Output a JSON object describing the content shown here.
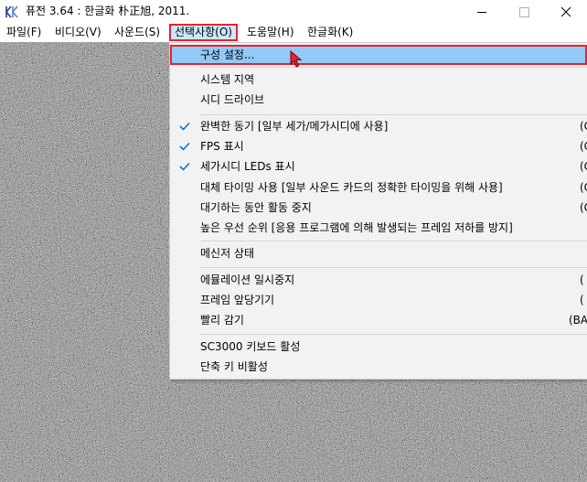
{
  "window": {
    "title": "퓨전 3.64 : 한글화 朴正旭, 2011.",
    "icon": "fusion-app-icon"
  },
  "colors": {
    "highlight_border": "#e8232f",
    "menu_hover": "#cce8ff",
    "item_highlight": "#91c9f7",
    "check": "#0078d7",
    "cursor": "#e8232f"
  },
  "menubar": {
    "items": [
      {
        "label": "파일(F)"
      },
      {
        "label": "비디오(V)"
      },
      {
        "label": "사운드(S)"
      },
      {
        "label": "선택사항(O)"
      },
      {
        "label": "도움말(H)"
      },
      {
        "label": "한글화(K)"
      }
    ]
  },
  "dropdown": {
    "items": [
      {
        "label": "구성 설정...",
        "shortcut": "",
        "checked": false
      },
      {
        "label": "시스템 지역",
        "shortcut": "",
        "checked": false
      },
      {
        "label": "시디 드라이브",
        "shortcut": "",
        "checked": false
      },
      {
        "label": "완벽한 동기 [일부 세가/메가시디에 사용]",
        "shortcut": "(C",
        "checked": true
      },
      {
        "label": "FPS 표시",
        "shortcut": "(C",
        "checked": true
      },
      {
        "label": "세가시디 LEDs 표시",
        "shortcut": "(C",
        "checked": true
      },
      {
        "label": "대체 타이밍 사용 [일부 사운드 카드의 정확한 타이밍을 위해 사용]",
        "shortcut": "(C",
        "checked": false
      },
      {
        "label": "대기하는 동안 활동 중지",
        "shortcut": "(C",
        "checked": false
      },
      {
        "label": "높은 우선 순위 [응용 프로그램에 의해 발생되는 프레임 저하를 방지]",
        "shortcut": "",
        "checked": false
      },
      {
        "label": "메신저 상태",
        "shortcut": "",
        "checked": false
      },
      {
        "label": "에뮬레이션 일시중지",
        "shortcut": "(",
        "checked": false
      },
      {
        "label": "프레임 앞당기기",
        "shortcut": "(",
        "checked": false
      },
      {
        "label": "빨리 감기",
        "shortcut": "(BAC",
        "checked": false
      },
      {
        "label": "SC3000 키보드 활성",
        "shortcut": "",
        "checked": false
      },
      {
        "label": "단축 키 비활성",
        "shortcut": "",
        "checked": false
      }
    ]
  }
}
